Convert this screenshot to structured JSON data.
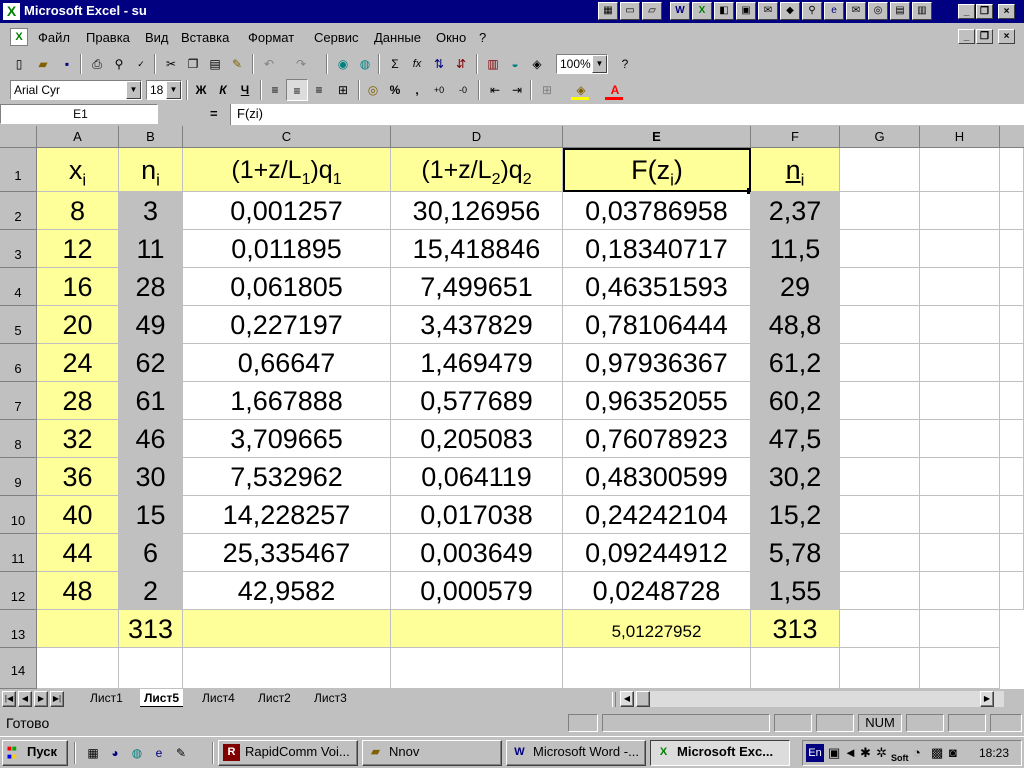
{
  "window": {
    "title": "Microsoft Excel - su"
  },
  "menu": [
    "Файл",
    "Правка",
    "Вид",
    "Вставка",
    "Формат",
    "Сервис",
    "Данные",
    "Окно",
    "?"
  ],
  "toolbar": {
    "zoom": "100%",
    "font": "Arial Cyr",
    "size": "18",
    "bold": "Ж",
    "italic": "К",
    "underline": "Ч",
    "sigma": "Σ",
    "fx": "fx",
    "percent": "%",
    "comma": ","
  },
  "formula_bar": {
    "cell_ref": "E1",
    "equals": "=",
    "formula": "F(zi)"
  },
  "grid": {
    "columns": [
      "A",
      "B",
      "C",
      "D",
      "E",
      "F",
      "G",
      "H"
    ],
    "selected_column": "E",
    "header": {
      "a": {
        "main": "x",
        "sub": "i"
      },
      "b": {
        "main": "n",
        "sub": "i"
      },
      "c": {
        "p1": "(1+z/L",
        "s1": "1",
        "p2": ")q",
        "s2": "1"
      },
      "d": {
        "p1": "(1+z/L",
        "s1": "2",
        "p2": ")q",
        "s2": "2"
      },
      "e": {
        "main": "F(z",
        "sub": "i",
        "tail": ")"
      },
      "f": {
        "main": "n",
        "sub": "i"
      }
    },
    "rows": [
      [
        "8",
        "3",
        "0,001257",
        "30,126956",
        "0,03786958",
        "2,37"
      ],
      [
        "12",
        "11",
        "0,011895",
        "15,418846",
        "0,18340717",
        "11,5"
      ],
      [
        "16",
        "28",
        "0,061805",
        "7,499651",
        "0,46351593",
        "29"
      ],
      [
        "20",
        "49",
        "0,227197",
        "3,437829",
        "0,78106444",
        "48,8"
      ],
      [
        "24",
        "62",
        "0,66647",
        "1,469479",
        "0,97936367",
        "61,2"
      ],
      [
        "28",
        "61",
        "1,667888",
        "0,577689",
        "0,96352055",
        "60,2"
      ],
      [
        "32",
        "46",
        "3,709665",
        "0,205083",
        "0,76078923",
        "47,5"
      ],
      [
        "36",
        "30",
        "7,532962",
        "0,064119",
        "0,48300599",
        "30,2"
      ],
      [
        "40",
        "15",
        "14,228257",
        "0,017038",
        "0,24242104",
        "15,2"
      ],
      [
        "44",
        "6",
        "25,335467",
        "0,003649",
        "0,09244912",
        "5,78"
      ],
      [
        "48",
        "2",
        "42,9582",
        "0,000579",
        "0,0248728",
        "1,55"
      ]
    ],
    "totals": {
      "b": "313",
      "e": "5,01227952",
      "f": "313"
    }
  },
  "sheet_tabs": [
    "Лист1",
    "Лист5",
    "Лист4",
    "Лист2",
    "Лист3"
  ],
  "active_sheet": "Лист5",
  "status": {
    "text": "Готово",
    "num": "NUM"
  },
  "taskbar": {
    "start": "Пуск",
    "tasks": [
      "RapidComm Voi...",
      "Nnov",
      "Microsoft Word -...",
      "Microsoft Exc..."
    ],
    "tray_lang": "En",
    "tray_soft": "Soft",
    "clock": "18:23"
  }
}
